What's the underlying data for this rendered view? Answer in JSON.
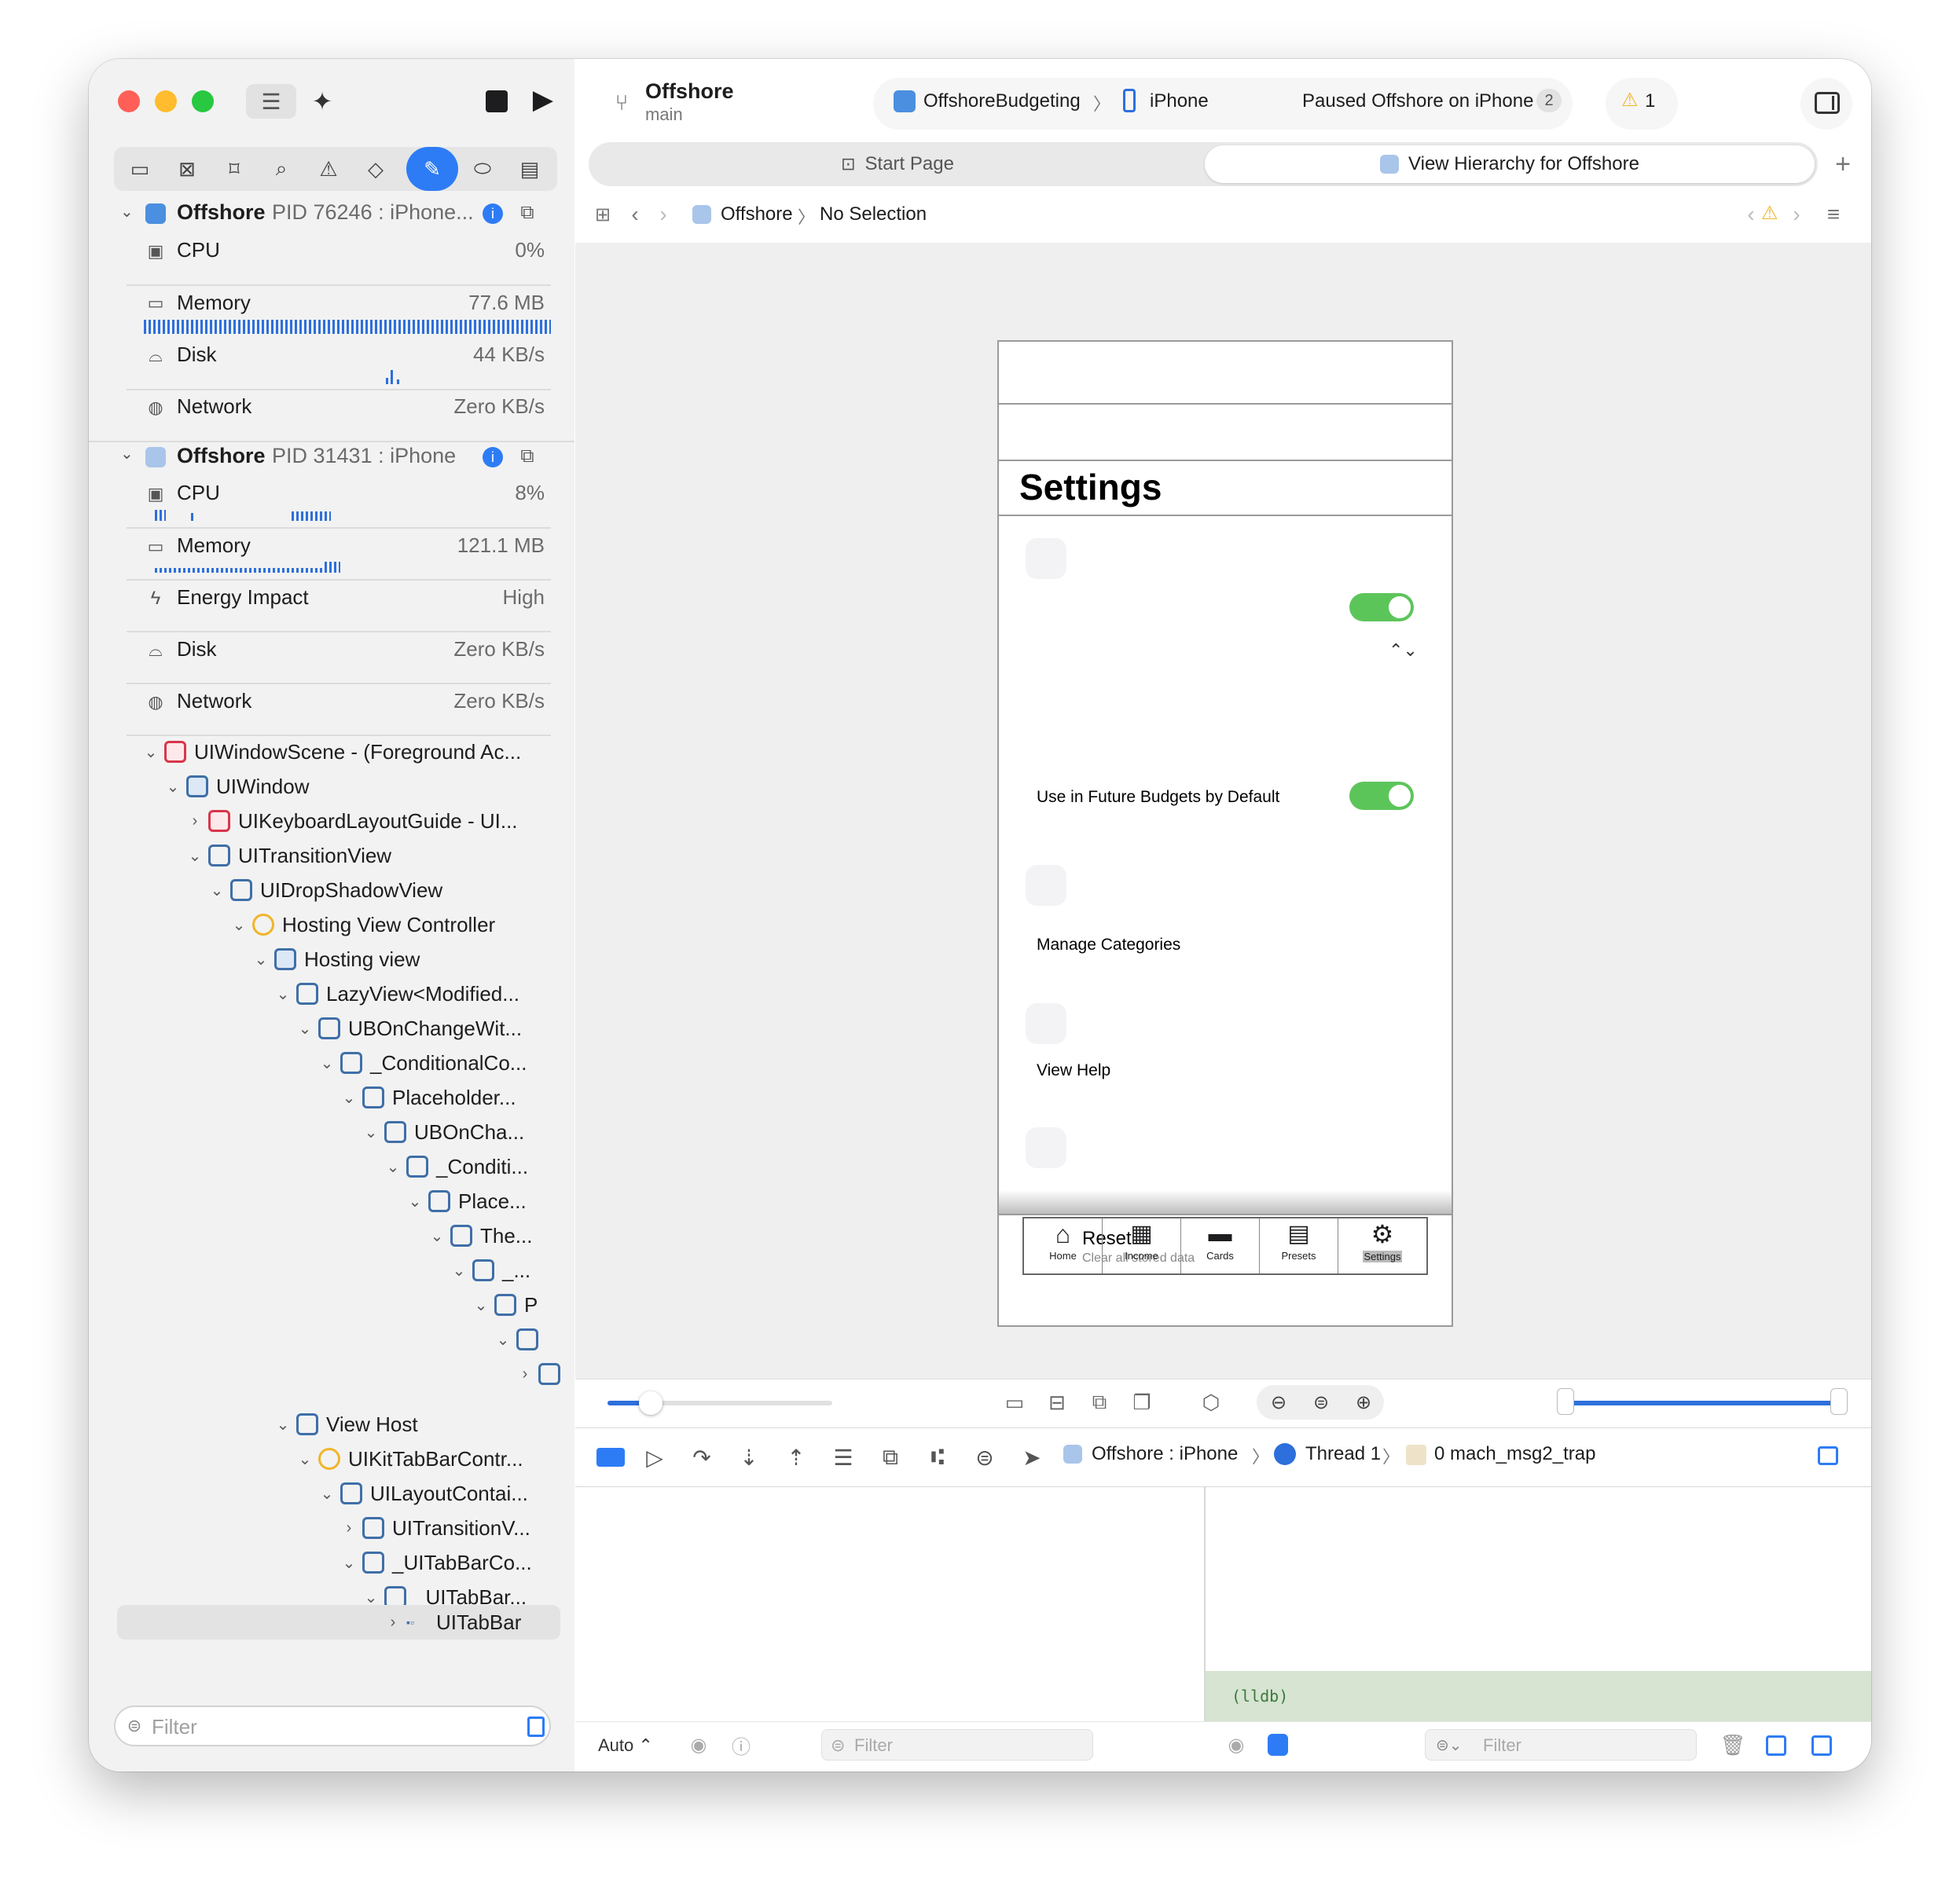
{
  "toolbar": {
    "project_name": "Offshore",
    "branch": "main",
    "scheme": "OffshoreBudgeting",
    "device": "iPhone",
    "status": "Paused Offshore on iPhone",
    "status_count": "2",
    "warnings": "1"
  },
  "tabs": [
    {
      "label": "Start Page"
    },
    {
      "label": "View Hierarchy for Offshore"
    }
  ],
  "jumpbar": {
    "app": "Offshore",
    "selection": "No Selection"
  },
  "debug_nav": {
    "process1": {
      "name": "Offshore",
      "pid": "PID 76246 : iPhone...",
      "gauges": [
        {
          "label": "CPU",
          "value": "0%"
        },
        {
          "label": "Memory",
          "value": "77.6 MB"
        },
        {
          "label": "Disk",
          "value": "44 KB/s"
        },
        {
          "label": "Network",
          "value": "Zero KB/s"
        }
      ]
    },
    "process2": {
      "name": "Offshore",
      "pid": "PID 31431 : iPhone",
      "gauges": [
        {
          "label": "CPU",
          "value": "8%"
        },
        {
          "label": "Memory",
          "value": "121.1 MB"
        },
        {
          "label": "Energy Impact",
          "value": "High"
        },
        {
          "label": "Disk",
          "value": "Zero KB/s"
        },
        {
          "label": "Network",
          "value": "Zero KB/s"
        }
      ]
    },
    "tree": [
      "UIWindowScene - (Foreground Ac...",
      "UIWindow",
      "UIKeyboardLayoutGuide - UI...",
      "UITransitionView",
      "UIDropShadowView",
      "Hosting View Controller",
      "Hosting view",
      "LazyView<Modified...",
      "UBOnChangeWit...",
      "_ConditionalCo...",
      "Placeholder...",
      "UBOnCha...",
      "_Conditi...",
      "Place...",
      "The...",
      "_...",
      "P",
      "",
      "",
      "View Host",
      "UIKitTabBarContr...",
      "UILayoutContai...",
      "UITransitionV...",
      "_UITabBarCo...",
      "_UITabBar...",
      "UITabBar"
    ],
    "filter_placeholder": "Filter"
  },
  "phone": {
    "title": "Settings",
    "rows": [
      "Use in Future Budgets by Default",
      "Manage Categories",
      "View Help"
    ],
    "reset_title": "Reset",
    "reset_sub": "Clear all stored data",
    "tabbar": [
      "Home",
      "Income",
      "Cards",
      "Presets",
      "Settings"
    ]
  },
  "debugbar": {
    "process": "Offshore : iPhone",
    "thread": "Thread 1",
    "frame": "0 mach_msg2_trap"
  },
  "console": {
    "prompt": "(lldb)",
    "auto_label": "Auto",
    "filter_placeholder": "Filter"
  }
}
